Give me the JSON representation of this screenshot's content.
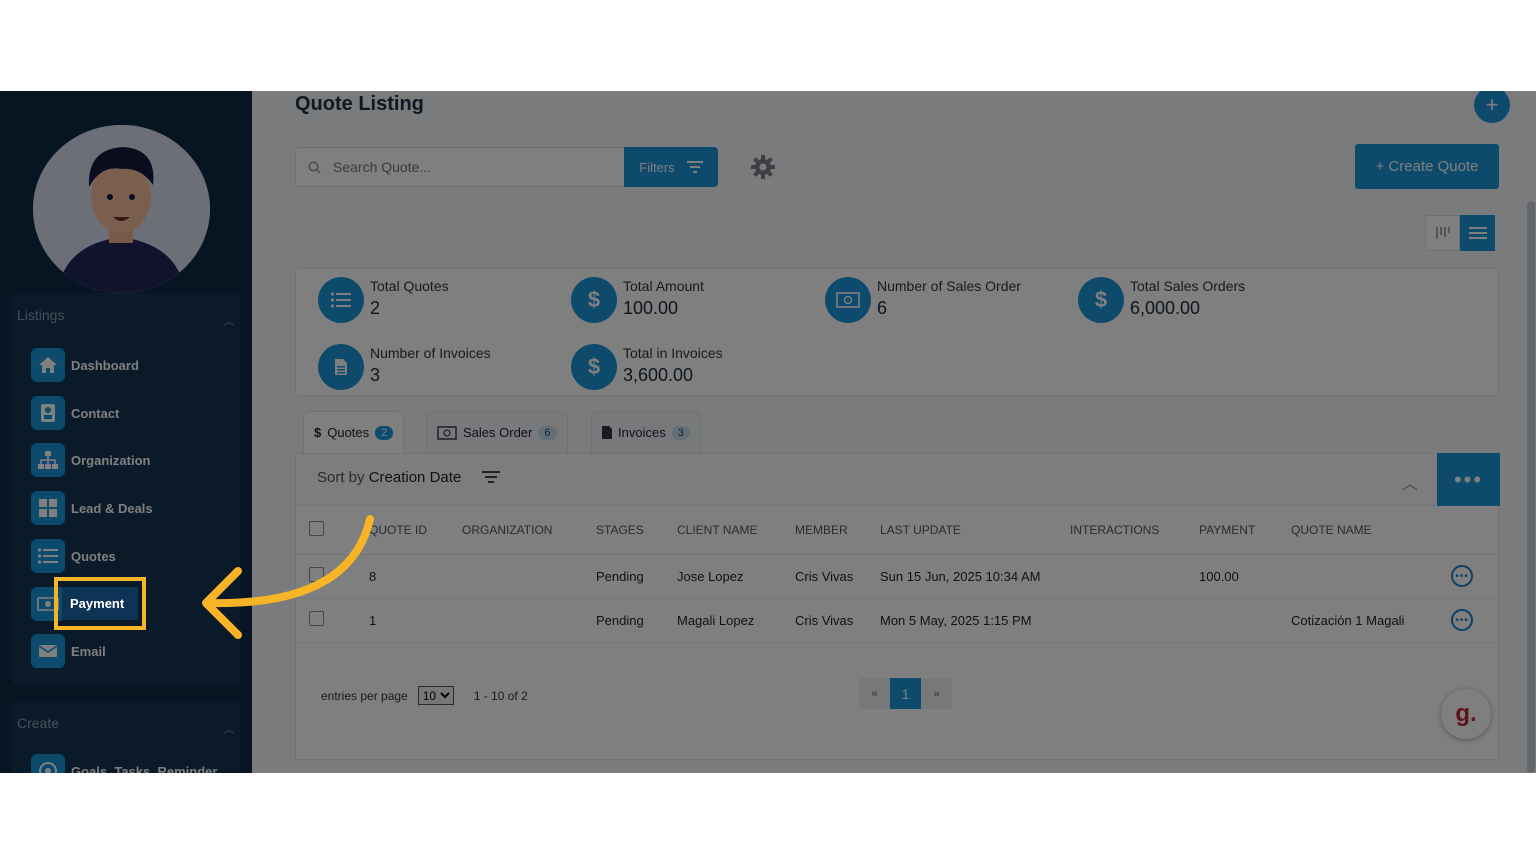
{
  "sidebar": {
    "listings_header": "Listings",
    "create_header": "Create",
    "items": [
      {
        "label": "Dashboard",
        "icon": "home-icon"
      },
      {
        "label": "Contact",
        "icon": "contact-card-icon"
      },
      {
        "label": "Organization",
        "icon": "org-chart-icon"
      },
      {
        "label": "Lead & Deals",
        "icon": "grid-icon"
      },
      {
        "label": "Quotes",
        "icon": "list-icon"
      },
      {
        "label": "Payment",
        "icon": "money-icon"
      },
      {
        "label": "Email",
        "icon": "envelope-icon"
      }
    ],
    "create_items": [
      {
        "label": "Goals, Tasks, Reminder",
        "icon": "target-icon"
      }
    ]
  },
  "header": {
    "title": "Quote Listing",
    "search_placeholder": "Search Quote...",
    "filters_label": "Filters",
    "create_label": "+ Create Quote"
  },
  "stats": [
    {
      "label": "Total Quotes",
      "value": "2",
      "icon": "list-icon"
    },
    {
      "label": "Total Amount",
      "value": "100.00",
      "icon": "dollar-icon"
    },
    {
      "label": "Number of Sales Order",
      "value": "6",
      "icon": "banknote-icon"
    },
    {
      "label": "Total Sales Orders",
      "value": "6,000.00",
      "icon": "dollar-icon"
    },
    {
      "label": "Number of Invoices",
      "value": "3",
      "icon": "document-icon"
    },
    {
      "label": "Total in Invoices",
      "value": "3,600.00",
      "icon": "dollar-icon"
    }
  ],
  "tabs": [
    {
      "label": "Quotes",
      "count": "2",
      "glyph": "$"
    },
    {
      "label": "Sales Order",
      "count": "6"
    },
    {
      "label": "Invoices",
      "count": "3"
    }
  ],
  "sort": {
    "prefix": "Sort by",
    "field": "Creation Date"
  },
  "table": {
    "columns": [
      "QUOTE ID",
      "ORGANIZATION",
      "STAGES",
      "CLIENT NAME",
      "MEMBER",
      "LAST UPDATE",
      "INTERACTIONS",
      "PAYMENT",
      "QUOTE NAME"
    ],
    "rows": [
      {
        "id": "8",
        "organization": "",
        "stage": "Pending",
        "client": "Jose Lopez",
        "member": "Cris Vivas",
        "last_update": "Sun 15 Jun, 2025 10:34 AM",
        "interactions": "",
        "payment": "100.00",
        "quote_name": ""
      },
      {
        "id": "1",
        "organization": "",
        "stage": "Pending",
        "client": "Magali Lopez",
        "member": "Cris Vivas",
        "last_update": "Mon 5 May, 2025 1:15 PM",
        "interactions": "",
        "payment": "",
        "quote_name": "Cotización 1 Magali"
      }
    ]
  },
  "pagination": {
    "entries_label": "entries per page",
    "per_page": "10",
    "range": "1 - 10 of 2",
    "prev": "«",
    "current": "1",
    "next": "»"
  },
  "chat_widget": {
    "glyph": "g."
  },
  "colors": {
    "accent": "#1a95d6",
    "sidebar": "#0f2a44",
    "highlight": "#f6b426"
  }
}
